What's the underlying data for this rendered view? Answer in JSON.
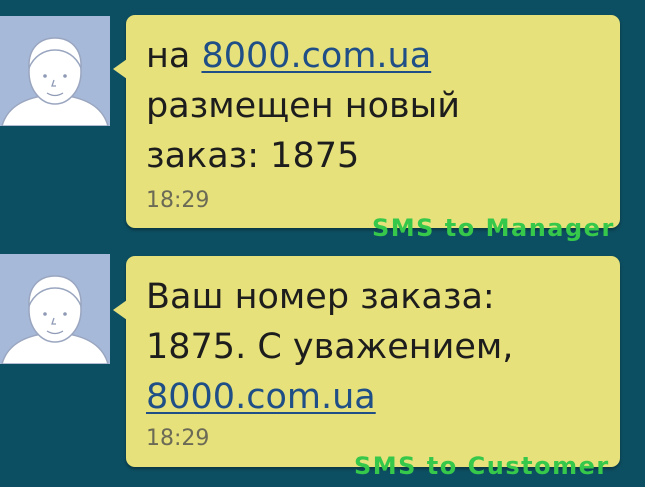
{
  "messages": [
    {
      "line1_prefix": "на ",
      "line1_link": "8000.com.ua",
      "line2": "размещен новый",
      "line3": "заказ: 1875",
      "time": "18:29",
      "caption": "SMS to Manager"
    },
    {
      "line1": "Ваш номер заказа:",
      "line2": "1875. С уважением,",
      "line3_link": "8000.com.ua",
      "time": "18:29",
      "caption": "SMS to Customer"
    }
  ],
  "colors": {
    "background": "#0d4f62",
    "bubble": "#e6e17a",
    "avatar": "#a6b9d8",
    "link": "#1f4f86",
    "caption": "#36c84a"
  },
  "icons": {
    "avatar": "default-contact-avatar-icon"
  }
}
